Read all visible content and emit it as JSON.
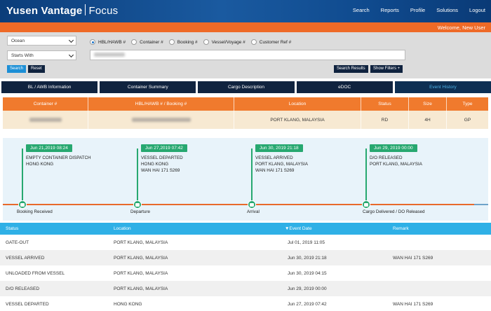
{
  "brand": {
    "company": "Yusen Vantage",
    "product": "Focus"
  },
  "topnav": [
    "Search",
    "Reports",
    "Profile",
    "Solutions",
    "Logout"
  ],
  "welcome": "Welcome, New User",
  "search": {
    "mode_select": "Ocean",
    "match_select": "Starts With",
    "radio_options": [
      "HBL/HAWB #",
      "Container #",
      "Booking #",
      "Vessel/Voyage #",
      "Customer Ref #"
    ],
    "selected_radio": 0,
    "search_button": "Search",
    "reset_button": "Reset",
    "search_results_button": "Search Results",
    "show_filters_button": "Show Filters +"
  },
  "tabs": [
    "BL / AWB Information",
    "Container Summary",
    "Cargo Description",
    "eDOC",
    "Event History"
  ],
  "active_tab": 4,
  "container_table": {
    "headers": [
      "Container #",
      "HBL/HAWB # / Booking #",
      "Location",
      "Status",
      "Size",
      "Type"
    ],
    "row": {
      "location": "PORT KLANG, MALAYSIA",
      "status": "RD",
      "size": "4H",
      "type": "GP"
    }
  },
  "timeline": {
    "events": [
      {
        "date": "Jun 21,2019 08:24",
        "lines": [
          "EMPTY CONTAINER DISPATCH",
          "HONG KONG"
        ]
      },
      {
        "date": "Jun 27,2019 07:42",
        "lines": [
          "VESSEL DEPARTED",
          "HONG KONG",
          "WAN HAI 171 S269"
        ]
      },
      {
        "date": "Jun 30, 2019 21:18",
        "lines": [
          "VESSEL ARRIVED",
          "PORT KLANG, MALAYSIA",
          "WAN HAI 171 S269"
        ]
      },
      {
        "date": "Jun 29, 2019 00:00",
        "lines": [
          "D/O RELEASED",
          "PORT KLANG, MALAYSIA"
        ]
      }
    ],
    "milestones": [
      "Booking Received",
      "Departure",
      "Arrival",
      "Cargo Delivered / DO Released"
    ]
  },
  "event_table": {
    "headers": [
      "Status",
      "Location",
      "▼Event Date",
      "Remark"
    ],
    "rows": [
      [
        "GATE-OUT",
        "PORT KLANG, MALAYSIA",
        "Jul 01, 2019 11:05",
        ""
      ],
      [
        "VESSEL ARRIVED",
        "PORT KLANG, MALAYSIA",
        "Jun 30, 2019 21:18",
        "WAN HAI 171 S269"
      ],
      [
        "UNLOADED FROM VESSEL",
        "PORT KLANG, MALAYSIA",
        "Jun 30, 2019 04:15",
        ""
      ],
      [
        "D/O RELEASED",
        "PORT KLANG, MALAYSIA",
        "Jun 29, 2019 00:00",
        ""
      ],
      [
        "VESSEL DEPARTED",
        "HONG KONG",
        "Jun 27, 2019 07:42",
        "WAN HAI 171 S269"
      ]
    ]
  },
  "colors": {
    "header_blue": "#0b3d7a",
    "accent_orange": "#ee6a27",
    "timeline_green": "#27a870",
    "table_header_blue": "#2fb0e6",
    "tab_navy": "#10233f"
  }
}
